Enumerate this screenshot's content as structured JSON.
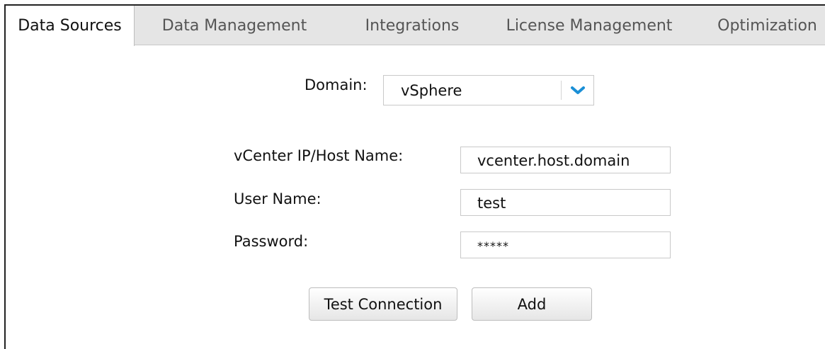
{
  "tabs": [
    {
      "label": "Data Sources",
      "active": true
    },
    {
      "label": "Data Management",
      "active": false
    },
    {
      "label": "Integrations",
      "active": false
    },
    {
      "label": "License Management",
      "active": false
    },
    {
      "label": "Optimization",
      "active": false
    }
  ],
  "form": {
    "domain_label": "Domain:",
    "domain_value": "vSphere",
    "vcenter_label": "vCenter IP/Host Name:",
    "vcenter_value": "vcenter.host.domain",
    "user_label": "User Name:",
    "user_value": "test",
    "password_label": "Password:",
    "password_value": "*****"
  },
  "buttons": {
    "test_connection": "Test Connection",
    "add": "Add"
  },
  "colors": {
    "accent": "#1a8fd6",
    "tab_bar": "#e5e5e5"
  },
  "icons": {
    "domain_dropdown": "chevron-down-icon"
  }
}
